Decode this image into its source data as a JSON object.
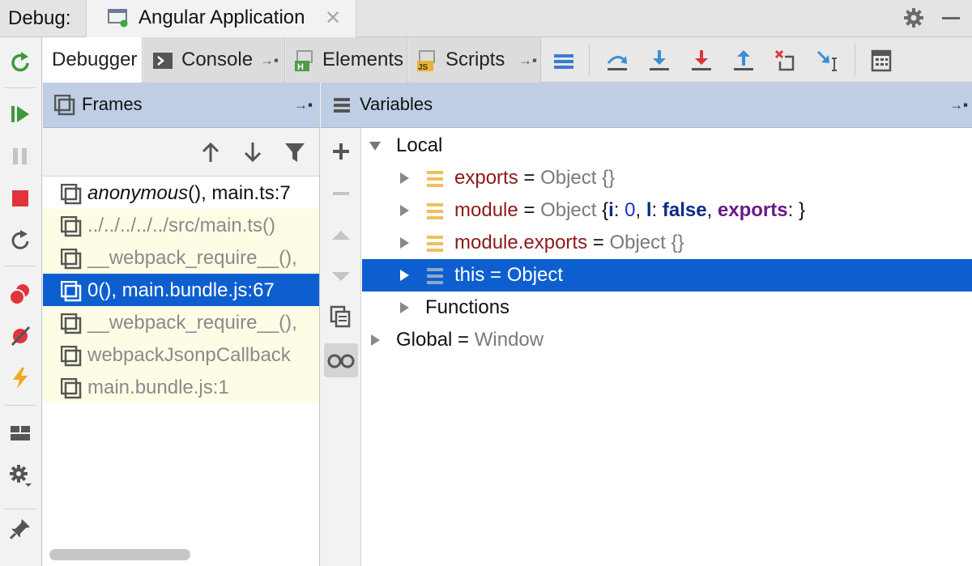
{
  "titlebar": {
    "debug_label": "Debug:",
    "app_tab": "Angular Application",
    "close_glyph": "✕"
  },
  "tabs": [
    {
      "label": "Debugger",
      "active": true
    },
    {
      "label": "Console",
      "icon": "console-icon"
    },
    {
      "label": "Elements",
      "icon": "html-file-icon"
    },
    {
      "label": "Scripts",
      "icon": "js-file-icon"
    }
  ],
  "pin_glyph": "→▪",
  "frames": {
    "title": "Frames",
    "rows": [
      {
        "text_italic": "anonymous",
        "text_rest": "(), main.ts:7",
        "type": "normal"
      },
      {
        "text": "../../../../../src/main.ts()",
        "type": "lib"
      },
      {
        "text": "__webpack_require__(),",
        "type": "lib"
      },
      {
        "text": "0(), main.bundle.js:67",
        "type": "selected"
      },
      {
        "text": "__webpack_require__(),",
        "type": "lib"
      },
      {
        "text": "webpackJsonpCallback",
        "type": "lib"
      },
      {
        "text": "main.bundle.js:1",
        "type": "lib"
      }
    ]
  },
  "variables": {
    "title": "Variables",
    "local": "Local",
    "exports": {
      "name": "exports",
      "eq": " = ",
      "val": "Object {}"
    },
    "module": {
      "name": "module",
      "eq": " = ",
      "obj": "Object ",
      "b1": "{",
      "i_key": "i",
      "c1": ": ",
      "i_val": "0",
      "sep1": ", ",
      "l_key": "l",
      "c2": ": ",
      "l_val": "false",
      "sep2": ", ",
      "exp_key": "exports",
      "c3": ": ",
      "b2": "}"
    },
    "module_exports": {
      "name": "module.exports",
      "eq": " = ",
      "val": "Object {}"
    },
    "this_row": "this = Object",
    "functions": "Functions",
    "global": {
      "name": "Global",
      "eq": " = ",
      "val": "Window"
    }
  },
  "colors": {
    "selection": "#0d5fcf",
    "panel_header": "#bfcee4",
    "library_frame_bg": "#fdfde6",
    "var_name": "#8b1a1a"
  }
}
